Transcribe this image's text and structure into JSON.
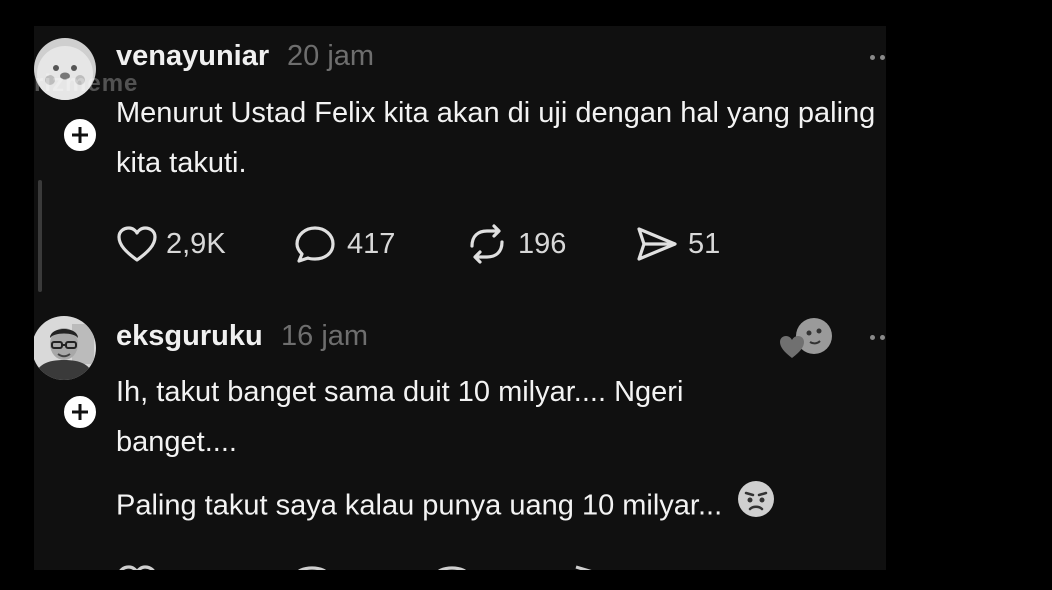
{
  "watermark": "rizmeme",
  "posts": [
    {
      "username": "venayuniar",
      "time": "20 jam",
      "text": "Menurut Ustad Felix kita akan di uji dengan hal yang paling kita takuti.",
      "avatar_icon": "seal-cartoon-avatar",
      "actions": {
        "likes": "2,9K",
        "comments": "417",
        "reposts": "196",
        "shares": "51"
      }
    },
    {
      "username": "eksguruku",
      "time": "16 jam",
      "text_line1": "Ih, takut banget sama duit 10 milyar.... Ngeri banget....",
      "text_line2": "Paling takut saya kalau punya uang 10 milyar...",
      "avatar_icon": "man-with-glasses-avatar",
      "reaction_icon": "heart-moon-reaction-icon",
      "emoji_icon": "worried-face-emoji"
    }
  ],
  "colors": {
    "background": "#101010",
    "outer": "#000000",
    "text": "#f3f3f3",
    "muted": "#6e6e6e"
  }
}
